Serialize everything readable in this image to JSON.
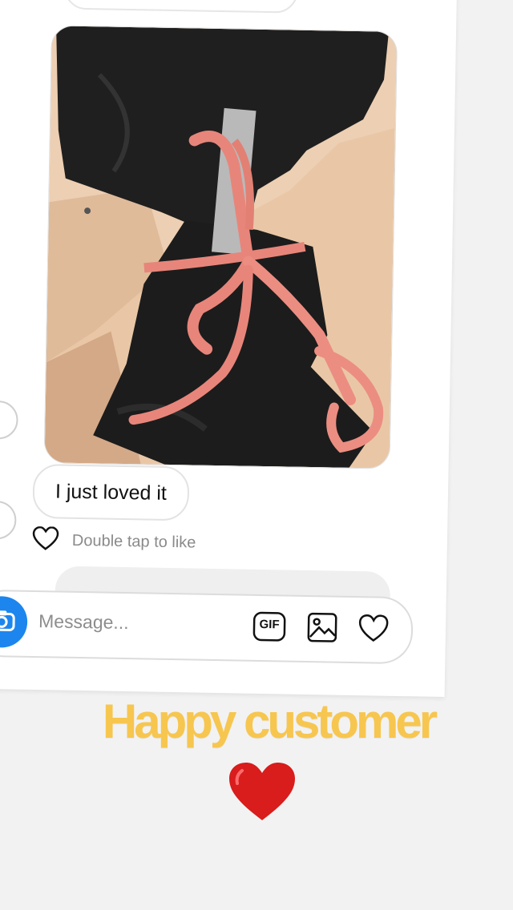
{
  "conversation": {
    "photo_alt": "Black fabric tied with a pink ribbon",
    "message_text": "I just loved it",
    "like_hint": "Double tap to like"
  },
  "composer": {
    "placeholder": "Message...",
    "gif_label": "GIF"
  },
  "overlay": {
    "caption": "Happy customer"
  },
  "colors": {
    "accent_blue": "#1c86ee",
    "caption_yellow": "#f7c64f",
    "heart_red": "#d91c1c",
    "ribbon_pink": "#e8857a"
  },
  "icons": {
    "camera": "camera-icon",
    "gif": "gif-icon",
    "gallery": "image-icon",
    "like": "heart-icon",
    "emoji": "red-heart-icon"
  }
}
